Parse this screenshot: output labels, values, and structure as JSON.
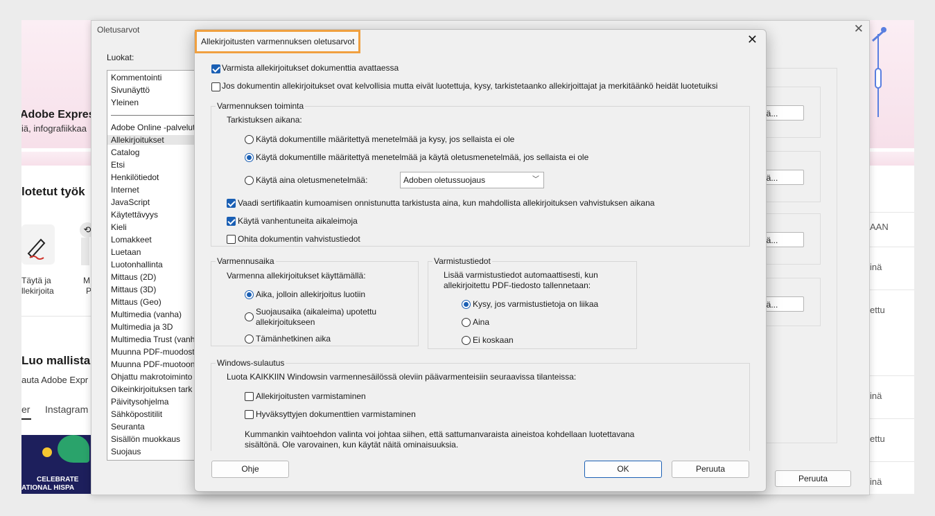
{
  "background_app": {
    "brand": "Adobe Expres",
    "subtitle": "iä, infografiikkaa",
    "section_title": "lotetut työk",
    "tool1": "Täytä ja\nllekirjoita",
    "tool2_a": "M",
    "tool2_b": "P",
    "create_title": "Luo mallista",
    "create_sub": "auta Adobe Expr",
    "tab1": "er",
    "tab2": "Instagram",
    "promo_line1": "CELEBRATE",
    "promo_line2": "ATIONAL HISPA",
    "right_rows": [
      "AAN",
      "inä",
      "ettu",
      "inä",
      "ettu",
      "inä"
    ]
  },
  "prefs_window": {
    "title": "Oletusarvot",
    "categories_label": "Luokat:",
    "categories_top": [
      "Kommentointi",
      "Sivunäyttö",
      "Yleinen"
    ],
    "categories": [
      "Adobe Online -palvelut",
      "Allekirjoitukset",
      "Catalog",
      "Etsi",
      "Henkilötiedot",
      "Internet",
      "JavaScript",
      "Käytettävyys",
      "Kieli",
      "Lomakkeet",
      "Luetaan",
      "Luotonhallinta",
      "Mittaus (2D)",
      "Mittaus (3D)",
      "Mittaus (Geo)",
      "Multimedia (vanha)",
      "Multimedia ja 3D",
      "Multimedia Trust (vanh",
      "Muunna PDF-muodost",
      "Muunna PDF-muotoon",
      "Ohjattu makrotoiminto",
      "Oikeinkirjoituksen tark",
      "Päivitysohjelma",
      "Sähköpostitilit",
      "Seuranta",
      "Sisällön muokkaus",
      "Suojaus"
    ],
    "selected_category": "Allekirjoitukset",
    "more_button": "ää...",
    "cancel_button": "Peruuta"
  },
  "dialog": {
    "title": "Allekirjoitusten varmennuksen oletusarvot",
    "check_verify_open": "Varmista allekirjoitukset dokumenttia avattaessa",
    "check_ask_trust": "Jos dokumentin allekirjoitukset ovat kelvollisia mutta eivät luotettuja, kysy, tarkistetaanko allekirjoittajat ja merkitäänkö heidät luotetuiksi",
    "behavior": {
      "legend": "Varmennuksen toiminta",
      "when_verifying": "Tarkistuksen aikana:",
      "radio1": "Käytä dokumentille määritettyä menetelmää ja kysy, jos sellaista ei ole",
      "radio2": "Käytä dokumentille määritettyä menetelmää ja käytä oletusmenetelmää, jos sellaista ei ole",
      "radio3": "Käytä aina oletusmenetelmää:",
      "select_value": "Adoben oletussuojaus",
      "check_revocation": "Vaadi sertifikaatin kumoamisen onnistunutta tarkistusta aina, kun mahdollista allekirjoituksen vahvistuksen aikana",
      "check_expired_ts": "Käytä vanhentuneita aikaleimoja",
      "check_ignore_doc": "Ohita dokumentin vahvistustiedot"
    },
    "verify_time": {
      "legend": "Varmennusaika",
      "prompt": "Varmenna allekirjoitukset käyttämällä:",
      "opt1": "Aika, jolloin allekirjoitus luotiin",
      "opt2": "Suojausaika (aikaleima) upotettu\nallekirjoitukseen",
      "opt3": "Tämänhetkinen aika"
    },
    "verify_info": {
      "legend": "Varmistustiedot",
      "prompt": "Lisää varmistustiedot automaattisesti, kun\nallekirjoitettu PDF-tiedosto tallennetaan:",
      "opt1": "Kysy, jos varmistustietoja on liikaa",
      "opt2": "Aina",
      "opt3": "Ei koskaan"
    },
    "windows": {
      "legend": "Windows-sulautus",
      "prompt": "Luota KAIKKIIN Windowsin varmennesäilössä oleviin päävarmenteisiin seuraavissa tilanteissa:",
      "check1": "Allekirjoitusten varmistaminen",
      "check2": "Hyväksyttyjen dokumenttien varmistaminen",
      "warning": "Kummankin vaihtoehdon valinta voi johtaa siihen, että sattumanvaraista aineistoa kohdellaan luotettavana\nsisältönä. Ole varovainen, kun käytät näitä ominaisuuksia."
    },
    "help_button": "Ohje",
    "ok_button": "OK",
    "cancel_button": "Peruuta"
  },
  "colors": {
    "accent": "#1a5fb4",
    "title_highlight": "#f0a040"
  }
}
